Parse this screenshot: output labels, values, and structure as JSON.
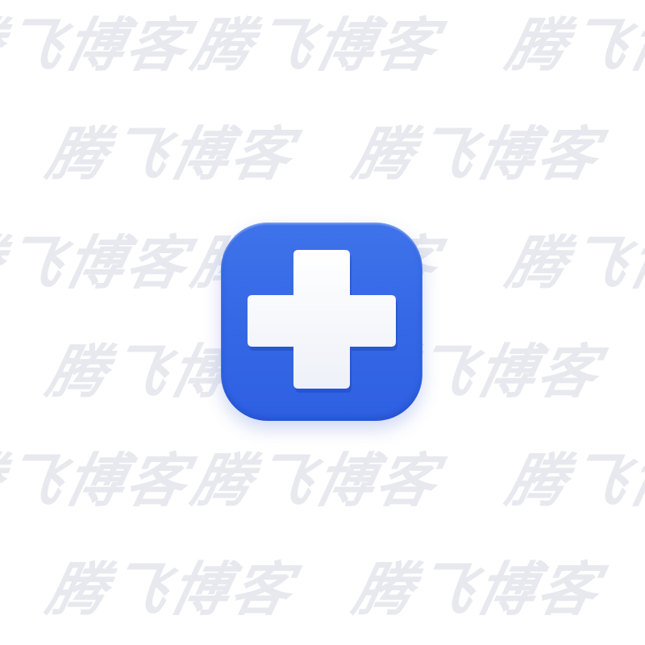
{
  "watermark": {
    "text": "腾飞博客",
    "color": "#e8e9ef"
  },
  "app_icon": {
    "icon_name": "medical-cross-icon",
    "background_color": "#3568e6",
    "symbol_color": "#ffffff"
  }
}
